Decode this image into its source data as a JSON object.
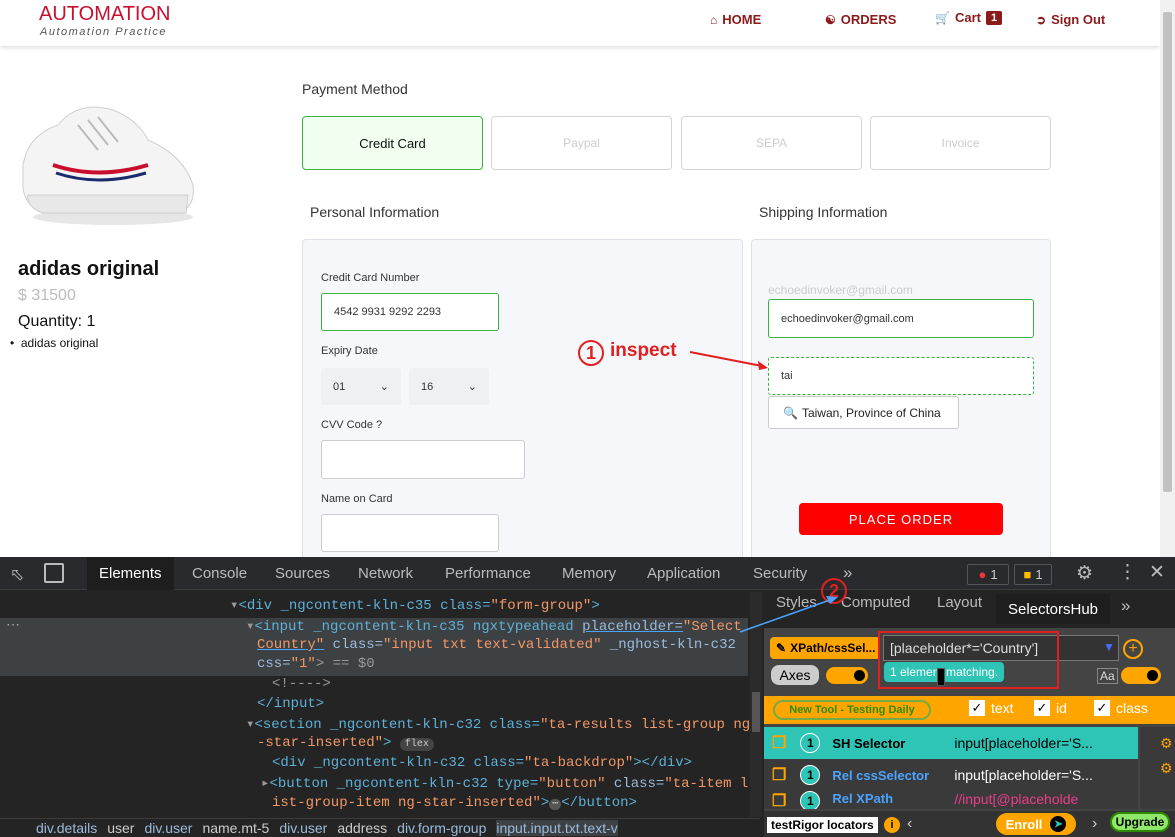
{
  "header": {
    "logo": "AUTOMATION",
    "logo_sub": "Automation Practice",
    "nav": {
      "home": "HOME",
      "orders": "ORDERS",
      "cart": "Cart",
      "cart_count": "1",
      "signout": "Sign Out"
    },
    "brand_color": "#8b1a1a"
  },
  "product": {
    "name": "adidas original",
    "price": "$ 31500",
    "quantity": "Quantity: 1",
    "items": [
      "adidas original"
    ]
  },
  "payment": {
    "title": "Payment Method",
    "methods": [
      "Credit Card",
      "Paypal",
      "SEPA",
      "Invoice"
    ],
    "selected": "Credit Card"
  },
  "personal": {
    "title": "Personal Information",
    "card_label": "Credit Card Number",
    "card_value": "4542 9931 9292 2293",
    "expiry_label": "Expiry Date",
    "expiry_month": "01",
    "expiry_year": "16",
    "cvv_label": "CVV Code ?",
    "name_label": "Name on Card"
  },
  "shipping": {
    "title": "Shipping Information",
    "email_label": "echoedinvoker@gmail.com",
    "email_value": "echoedinvoker@gmail.com",
    "country_value": "tai",
    "suggestion": "Taiwan, Province of China",
    "place_order": "PLACE ORDER"
  },
  "annotations": {
    "step1_num": "1",
    "step1_text": "inspect",
    "step2_num": "2",
    "color": "#e02020"
  },
  "devtools": {
    "tabs": [
      "Elements",
      "Console",
      "Sources",
      "Network",
      "Performance",
      "Memory",
      "Application",
      "Security"
    ],
    "active_tab": "Elements",
    "errors": "1",
    "warnings": "1",
    "code": {
      "line1": [
        "<div _ngcontent-kln-c35 class=",
        "\"form-group\"",
        ">"
      ],
      "line2a": "<input _ngcontent-kln-c35 ngxtypeahead ",
      "line2b": "placeholder=",
      "line2c": "\"Select",
      "line3a": "Country\"",
      "line3b": " class=",
      "line3c": "\"input txt text-validated\"",
      "line3d": " _nghost-kln-c32",
      "line4a": "css=",
      "line4b": "\"1\"",
      "line4c": "> == $0",
      "line5": "<!---->",
      "line6": "</input>",
      "line7a": "<section _ngcontent-kln-c32 class=",
      "line7b": "\"ta-results list-group ng",
      "line8a": "-star-inserted\"",
      "line8b": ">",
      "line8flex": "flex",
      "line9a": "<div _ngcontent-kln-c32 class=",
      "line9b": "\"ta-backdrop\"",
      "line9c": "></div>",
      "line10a": "<button _ngcontent-kln-c32 type=",
      "line10b": "\"button\"",
      "line10c": " class=",
      "line10d": "\"ta-item l",
      "line11a": "ist-group-item ng-star-inserted\"",
      "line11b": ">",
      "line11c": "</button>"
    },
    "breadcrumb": [
      "div.details",
      "user",
      "div.user",
      "name.mt-5",
      "div.user",
      "address",
      "div.form-group",
      "input.input.txt.text-v"
    ],
    "side_tabs": [
      "Styles",
      "Computed",
      "Layout",
      "SelectorsHub"
    ],
    "selectorshub": {
      "mode": "XPath/cssSel...",
      "query": "[placeholder*='Country']",
      "match": "1 element matching.",
      "axes": "Axes",
      "new_tool": "New Tool - Testing Daily",
      "chk_text": "text",
      "chk_id": "id",
      "chk_class": "class",
      "rows": [
        {
          "num": "1",
          "label": "SH Selector",
          "value": "input[placeholder='S..."
        },
        {
          "num": "1",
          "label": "Rel cssSelector",
          "value": "input[placeholder='S..."
        },
        {
          "num": "1",
          "label": "Rel XPath",
          "value": "//input[@placeholde"
        }
      ],
      "testrigor": "testRigor locators",
      "enroll": "Enroll",
      "upgrade": "Upgrade"
    }
  }
}
